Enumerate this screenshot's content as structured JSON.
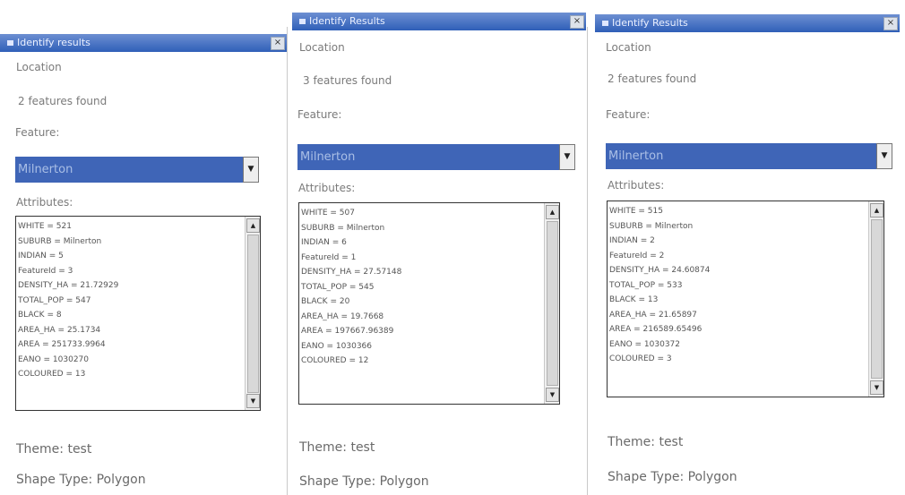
{
  "panels": [
    {
      "title": "Identify results",
      "close": "×",
      "location_label": "Location",
      "count_text": "2 features found",
      "feature_label": "Feature:",
      "selected_feature": "Milnerton",
      "attributes_label": "Attributes:",
      "attributes": [
        "WHITE = 521",
        "SUBURB = Milnerton",
        "INDIAN = 5",
        "FeatureId = 3",
        "DENSITY_HA = 21.72929",
        "TOTAL_POP = 547",
        "BLACK = 8",
        "AREA_HA = 25.1734",
        "AREA = 251733.9964",
        "EANO = 1030270",
        "COLOURED = 13"
      ],
      "theme_text": "Theme: test",
      "shape_text": "Shape Type: Polygon"
    },
    {
      "title": "Identify Results",
      "close": "×",
      "location_label": "Location",
      "count_text": "3 features found",
      "feature_label": "Feature:",
      "selected_feature": "Milnerton",
      "attributes_label": "Attributes:",
      "attributes": [
        "WHITE = 507",
        "SUBURB = Milnerton",
        "INDIAN = 6",
        "FeatureId = 1",
        "DENSITY_HA = 27.57148",
        "TOTAL_POP = 545",
        "BLACK = 20",
        "AREA_HA = 19.7668",
        "AREA = 197667.96389",
        "EANO = 1030366",
        "COLOURED = 12"
      ],
      "theme_text": "Theme: test",
      "shape_text": "Shape Type: Polygon"
    },
    {
      "title": "Identify Results",
      "close": "×",
      "location_label": "Location",
      "count_text": "2 features found",
      "feature_label": "Feature:",
      "selected_feature": "Milnerton",
      "attributes_label": "Attributes:",
      "attributes": [
        "WHITE = 515",
        "SUBURB = Milnerton",
        "INDIAN = 2",
        "FeatureId = 2",
        "DENSITY_HA = 24.60874",
        "TOTAL_POP = 533",
        "BLACK = 13",
        "AREA_HA = 21.65897",
        "AREA = 216589.65496",
        "EANO = 1030372",
        "COLOURED = 3"
      ],
      "theme_text": "Theme: test",
      "shape_text": "Shape Type: Polygon"
    }
  ],
  "colors": {
    "titlebar": "#2f5fb8",
    "selection": "#3f65b7"
  }
}
